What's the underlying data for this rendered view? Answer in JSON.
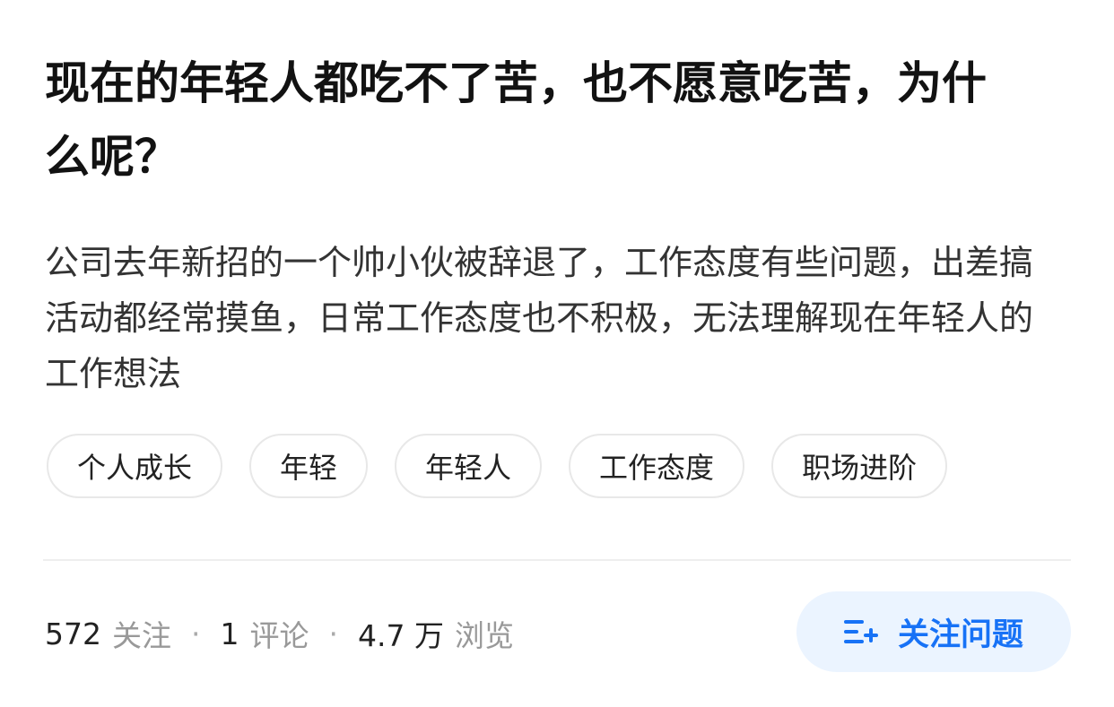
{
  "question": {
    "title": "现在的年轻人都吃不了苦，也不愿意吃苦，为什么呢？",
    "detail": "公司去年新招的一个帅小伙被辞退了，工作态度有些问题，出差搞活动都经常摸鱼，日常工作态度也不积极，无法理解现在年轻人的工作想法"
  },
  "tags": [
    "个人成长",
    "年轻",
    "年轻人",
    "工作态度",
    "职场进阶"
  ],
  "stats": {
    "follow_count": "572",
    "follow_label": "关注",
    "comment_count": "1",
    "comment_label": "评论",
    "view_count": "4.7 万",
    "view_label": "浏览",
    "separator": "·"
  },
  "follow_button": {
    "label": "关注问题",
    "icon": "follow-question-icon",
    "color": "#1772f6",
    "background": "#ebf4ff"
  }
}
